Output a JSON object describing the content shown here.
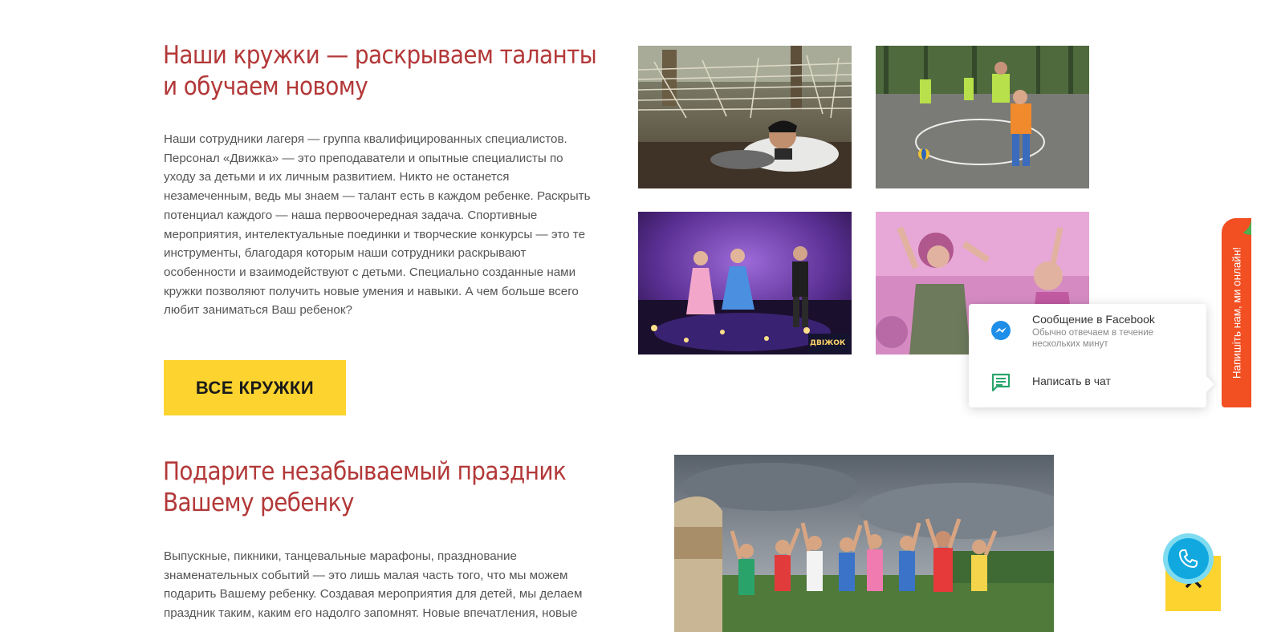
{
  "section_clubs": {
    "heading_line1": "Наши кружки — раскрываем таланты",
    "heading_line2": "и обучаем новому",
    "text_lines": [
      "Наши сотрудники лагеря — группа квалифицированных специалистов.",
      "Персонал «Движка» — это преподаватели и опытные специалисты по",
      "уходу за детьми и их личным развитием. Никто не останется",
      "незамеченным, ведь мы знаем — талант есть в каждом ребенке. Раскрыть",
      "потенциал каждого — наша первоочередная задача. Спортивные",
      "мероприятия, интелектуальные поединки и творческие конкурсы — это те",
      "инструменты, благодаря которым наши сотрудники раскрывают",
      "особенности и взаимодействуют с детьми. Специально созданные нами",
      "кружки позволяют получить новые умения и навыки. А чем больше всего",
      "любит заниматься Ваш ребенок?"
    ],
    "button_label": "ВСЕ КРУЖКИ",
    "stage_logo_text": "ДВІЖОК"
  },
  "section_holiday": {
    "heading_line1": "Подарите незабываемый праздник",
    "heading_line2": "Вашему ребенку",
    "text_lines": [
      "Выпускные, пикники, танцевальные марафоны, празднование",
      "знаменательных событий — это лишь малая часть того, что мы можем",
      "подарить Вашему ребенку. Создавая мероприятия для детей, мы делаем",
      "праздник таким, каким его надолго запомнят. Новые впечатления, новые"
    ]
  },
  "chat_widget": {
    "facebook_title": "Сообщение в Facebook",
    "facebook_subtitle": "Обычно отвечаем в течение нескольких минут",
    "web_chat_title": "Написать в чат",
    "tab_label": "Напишіть нам, ми онлайн!",
    "facebook_icon": "messenger-icon",
    "web_chat_icon": "chat-bubble-icon"
  },
  "floating_buttons": {
    "scroll_top_icon": "chevron-up-icon",
    "call_icon": "phone-icon"
  },
  "colors": {
    "heading": "#b33838",
    "accent_yellow": "#fdd32f",
    "tab_orange": "#f24f23",
    "call_blue": "#11a8e0",
    "messenger_blue": "#1f8ee8",
    "chat_green": "#2aa56d"
  }
}
